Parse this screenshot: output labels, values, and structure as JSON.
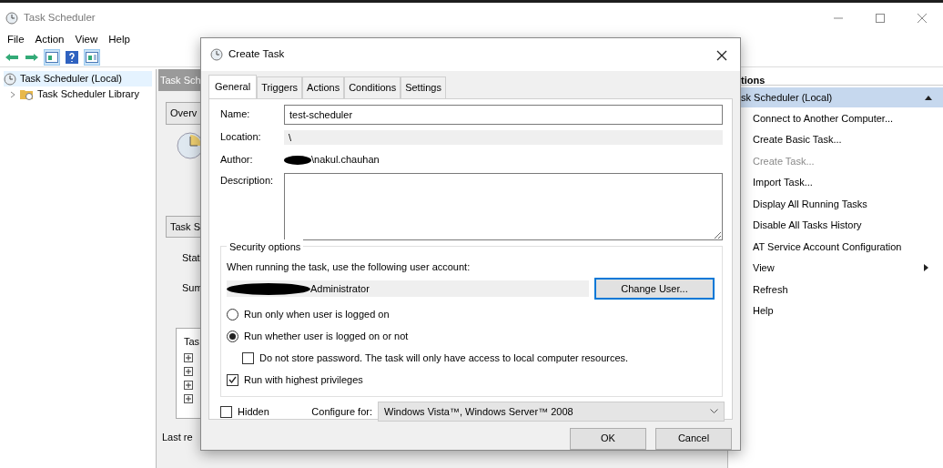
{
  "window": {
    "title": "Task Scheduler"
  },
  "menu": [
    "File",
    "Action",
    "View",
    "Help"
  ],
  "toolbar": [
    {
      "kind": "back",
      "selected": false
    },
    {
      "kind": "forward",
      "selected": false
    },
    {
      "kind": "pane",
      "selected": true
    },
    {
      "kind": "help",
      "selected": false
    },
    {
      "kind": "pane2",
      "selected": true
    }
  ],
  "tree": [
    {
      "label": "Task Scheduler (Local)",
      "selected": true,
      "children": [
        {
          "label": "Task Scheduler Library",
          "selected": false,
          "expanded": false
        }
      ]
    }
  ],
  "middle": {
    "header": "Task Sch",
    "overview": "Overv",
    "status_header": "Task S",
    "labels": [
      "Stat",
      "Sum"
    ],
    "list_header": "Tas",
    "footer": "Last re"
  },
  "actions": {
    "header": "tions",
    "group": "sk Scheduler (Local)",
    "items": [
      {
        "label": "Connect to Another Computer...",
        "disabled": false,
        "kind": "item"
      },
      {
        "label": "Create Basic Task...",
        "disabled": false,
        "kind": "item"
      },
      {
        "label": "Create Task...",
        "disabled": true,
        "kind": "item"
      },
      {
        "label": "Import Task...",
        "disabled": false,
        "kind": "item"
      },
      {
        "label": "Display All Running Tasks",
        "disabled": false,
        "kind": "item"
      },
      {
        "label": "Disable All Tasks History",
        "disabled": false,
        "kind": "item"
      },
      {
        "label": "AT Service Account Configuration",
        "disabled": false,
        "kind": "item"
      },
      {
        "label": "View",
        "disabled": false,
        "kind": "submenu"
      },
      {
        "label": "Refresh",
        "disabled": false,
        "kind": "item"
      },
      {
        "label": "Help",
        "disabled": false,
        "kind": "item"
      }
    ]
  },
  "dialog": {
    "title": "Create Task",
    "tabs": [
      {
        "label": "General",
        "selected": true
      },
      {
        "label": "Triggers",
        "selected": false
      },
      {
        "label": "Actions",
        "selected": false
      },
      {
        "label": "Conditions",
        "selected": false
      },
      {
        "label": "Settings",
        "selected": false
      }
    ],
    "name_label": "Name:",
    "name_value": "test-scheduler",
    "location_label": "Location:",
    "location_value": "\\",
    "author_label": "Author:",
    "author_value": "\\nakul.chauhan",
    "description_label": "Description:",
    "security": {
      "title": "Security options",
      "prompt": "When running the task, use the following user account:",
      "account": "Administrator",
      "change_user": "Change User...",
      "options": [
        {
          "kind": "radio",
          "label": "Run only when user is logged on",
          "checked": false,
          "indent": false
        },
        {
          "kind": "radio",
          "label": "Run whether user is logged on or not",
          "checked": true,
          "indent": false
        },
        {
          "kind": "checkbox",
          "label": "Do not store password.  The task will only have access to local computer resources.",
          "checked": false,
          "indent": true
        },
        {
          "kind": "checkbox",
          "label": "Run with highest privileges",
          "checked": true,
          "indent": false
        }
      ]
    },
    "hidden": {
      "label": "Hidden",
      "checked": false
    },
    "configure_label": "Configure for:",
    "configure_value": "Windows Vista™, Windows Server™ 2008",
    "buttons": [
      "OK",
      "Cancel"
    ]
  }
}
